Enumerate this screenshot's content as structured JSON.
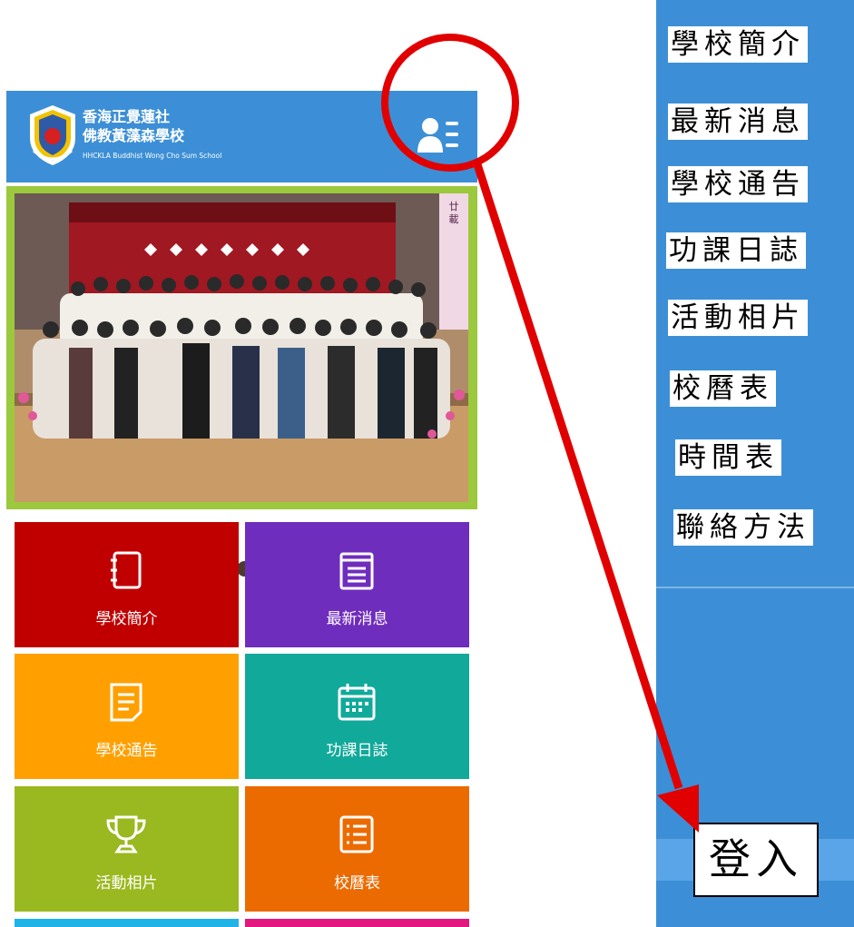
{
  "header": {
    "school_name_line1": "香海正覺蓮社",
    "school_name_line2": "佛教黃藻森學校",
    "school_name_en": "HHCKLA Buddhist Wong Cho Sum School",
    "menu_icon": "user-menu-icon"
  },
  "slider": {
    "slide_count": 10,
    "active_slide": 1,
    "banner_text": "廿載 維新育苗迎未來"
  },
  "tiles": [
    {
      "label": "學校簡介",
      "icon": "notebook-icon",
      "color": "#c00000"
    },
    {
      "label": "最新消息",
      "icon": "news-icon",
      "color": "#6f2dbd"
    },
    {
      "label": "學校通告",
      "icon": "notice-icon",
      "color": "#ffa000"
    },
    {
      "label": "功課日誌",
      "icon": "calendar-icon",
      "color": "#11a99a"
    },
    {
      "label": "活動相片",
      "icon": "trophy-icon",
      "color": "#9ab81f"
    },
    {
      "label": "校曆表",
      "icon": "list-icon",
      "color": "#ec6b00"
    }
  ],
  "tiles_partial_colors": [
    "#1fb3e8",
    "#e4167f"
  ],
  "menu": {
    "items": [
      "學校簡介",
      "最新消息",
      "學校通告",
      "功課日誌",
      "活動相片",
      "校曆表",
      "時間表",
      "聯絡方法"
    ],
    "login_label": "登入",
    "panel_color": "#3c8fd6"
  },
  "annotation": {
    "circle_color": "#e10000",
    "arrow_color": "#e10000"
  }
}
